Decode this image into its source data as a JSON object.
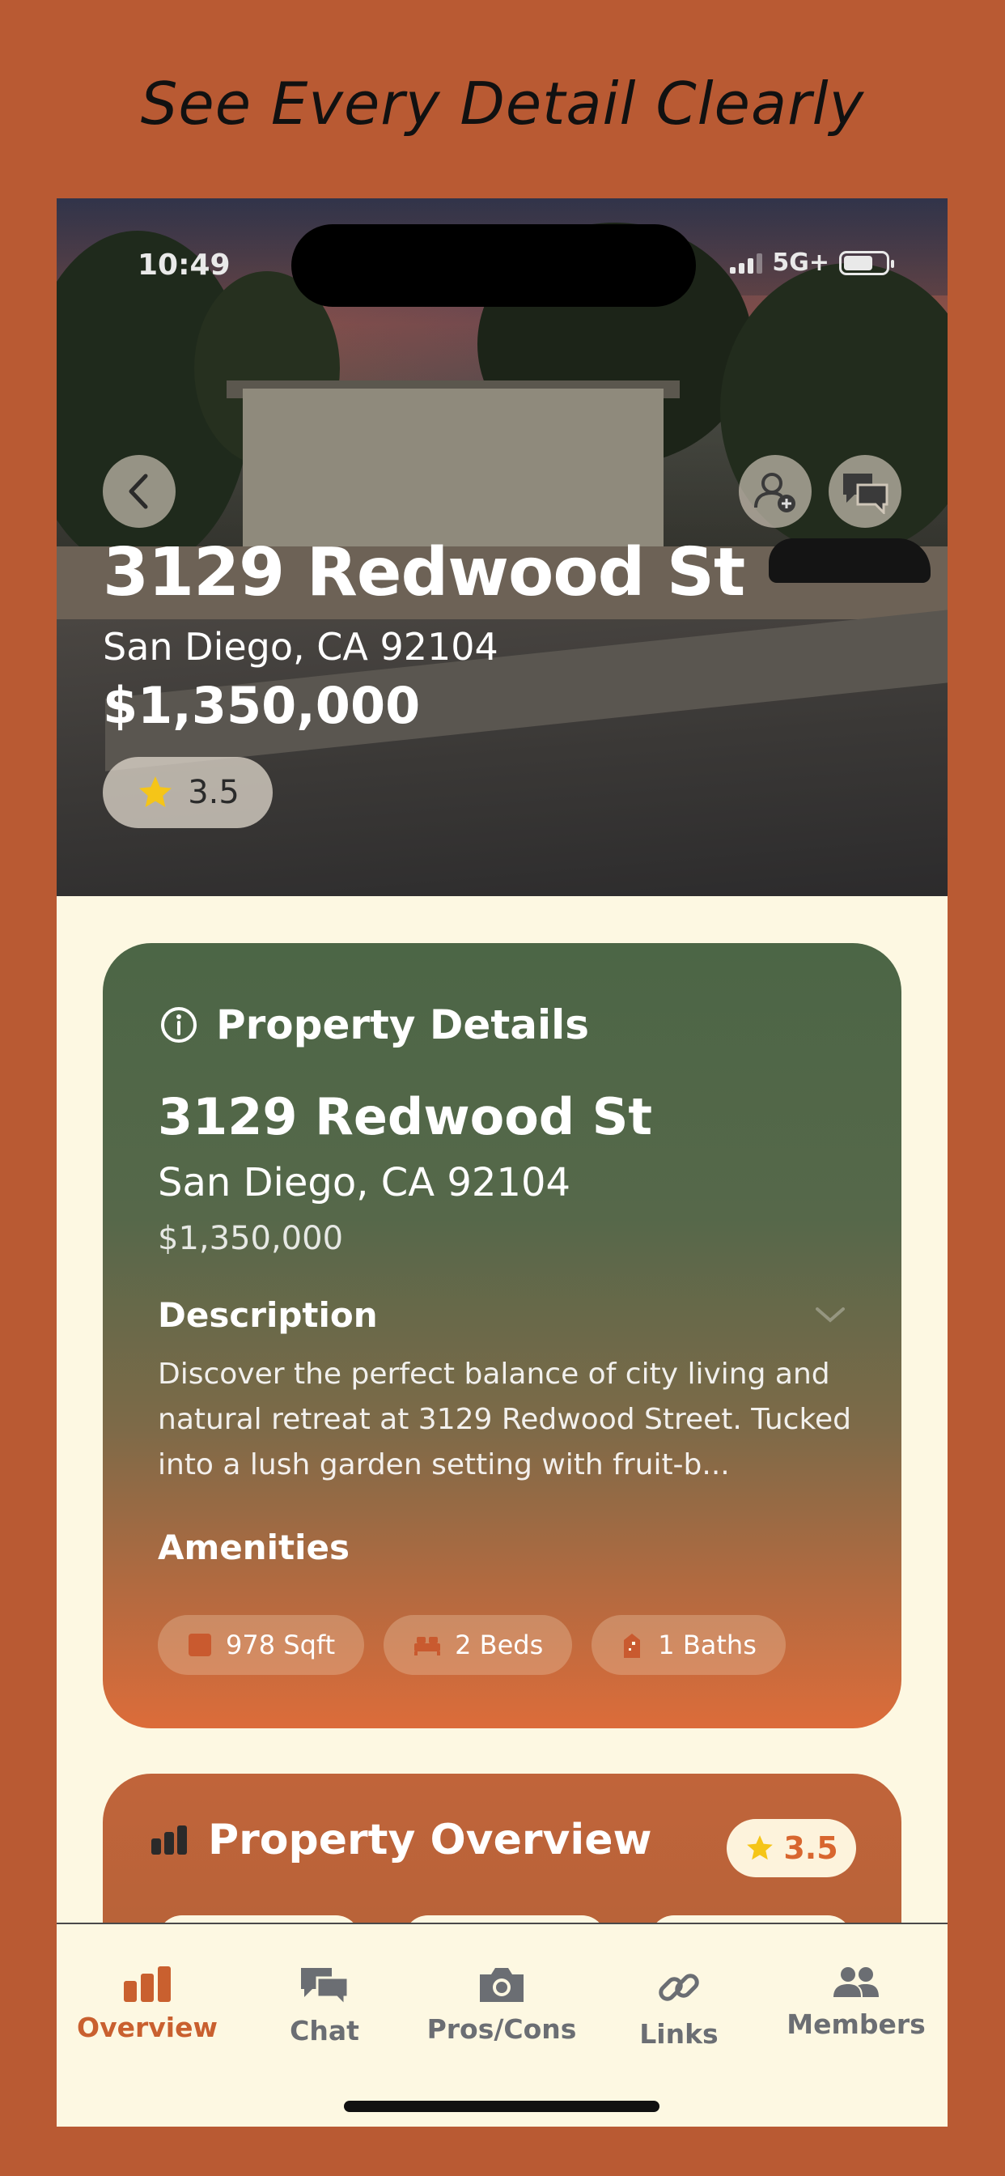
{
  "headline": "See Every Detail Clearly",
  "status_bar": {
    "time": "10:49",
    "network": "5G+"
  },
  "hero": {
    "title": "3129 Redwood St",
    "city": "San Diego, CA 92104",
    "price": "$1,350,000",
    "rating": "3.5"
  },
  "details_card": {
    "header": "Property Details",
    "title": "3129 Redwood St",
    "city": "San Diego, CA 92104",
    "price": "$1,350,000",
    "description_label": "Description",
    "description": "Discover the perfect balance of city living and natural retreat at 3129 Redwood Street. Tucked into a lush garden setting with fruit-b...",
    "amenities_label": "Amenities",
    "amenities": [
      {
        "icon": "square-icon",
        "label": "978 Sqft"
      },
      {
        "icon": "bed-icon",
        "label": "2 Beds"
      },
      {
        "icon": "shower-icon",
        "label": "1 Baths"
      }
    ]
  },
  "overview_card": {
    "header": "Property Overview",
    "rating": "3.5"
  },
  "tabs": [
    {
      "icon": "chart-icon",
      "label": "Overview",
      "active": true
    },
    {
      "icon": "chat-icon",
      "label": "Chat",
      "active": false
    },
    {
      "icon": "camera-icon",
      "label": "Pros/Cons",
      "active": false
    },
    {
      "icon": "link-icon",
      "label": "Links",
      "active": false
    },
    {
      "icon": "members-icon",
      "label": "Members",
      "active": false
    }
  ],
  "colors": {
    "background": "#b95a33",
    "accent": "#c9602f",
    "card_green": "#4c6646",
    "card_orange": "#dc6c3a",
    "surface": "#fdf8e2",
    "star": "#f5c518"
  }
}
